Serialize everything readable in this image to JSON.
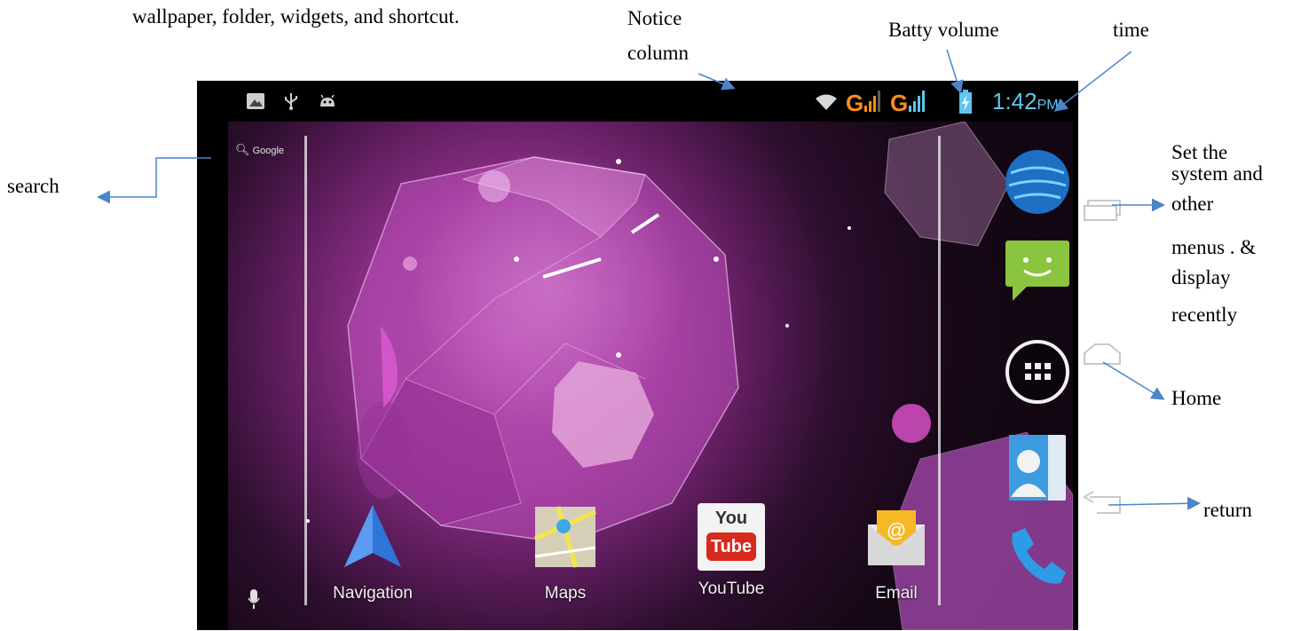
{
  "annotations": {
    "intro": "wallpaper, folder, widgets, and shortcut.",
    "notice_line1": "Notice",
    "notice_line2": "column",
    "battery": "Batty volume",
    "time": "time",
    "search": "search",
    "recent_line1": "Set the",
    "recent_line2": "system and",
    "recent_line3": "other",
    "recent_line4": "menus . &",
    "recent_line5": "display",
    "recent_line6": "recently",
    "home": "Home",
    "return": "return"
  },
  "status_bar": {
    "left_icons": [
      "gallery-icon",
      "usb-icon",
      "android-debug-icon"
    ],
    "signal1_label": "G",
    "signal2_label": "G",
    "time": "1:42",
    "ampm": "PM",
    "wifi_icon": "wifi-icon",
    "battery_icon": "battery-charging-icon"
  },
  "home": {
    "search_label": "Google",
    "voice_icon": "mic-icon",
    "dock": [
      {
        "label": "Navigation",
        "icon": "navigation-icon"
      },
      {
        "label": "Maps",
        "icon": "maps-icon"
      },
      {
        "label": "YouTube",
        "icon": "youtube-icon",
        "logo_line1": "You",
        "logo_line2": "Tube"
      },
      {
        "label": "Email",
        "icon": "email-icon"
      }
    ],
    "hotseat": [
      "browser-icon",
      "messaging-icon",
      "all-apps-icon",
      "contacts-icon",
      "phone-icon"
    ]
  },
  "navbar": {
    "buttons": [
      "recent-apps-icon",
      "home-icon",
      "back-icon"
    ]
  },
  "colors": {
    "arrow": "#4a86c8",
    "status_time": "#5fc6ef",
    "signal": "#ff8c1a"
  }
}
